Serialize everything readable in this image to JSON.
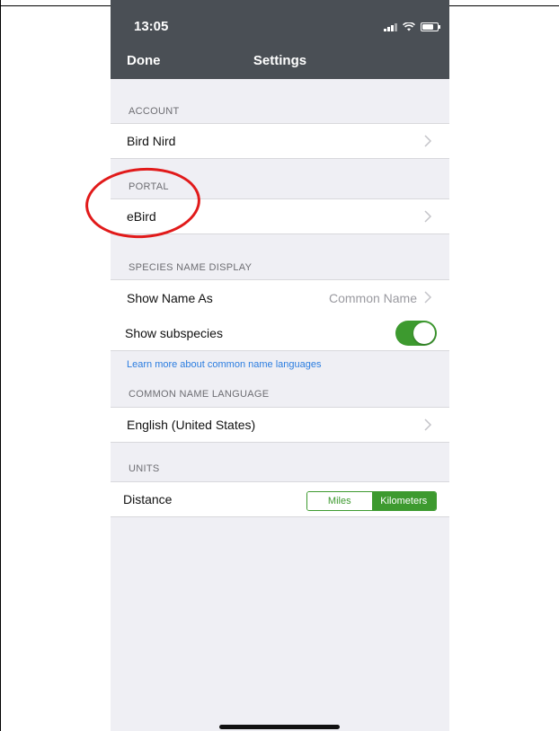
{
  "status_bar": {
    "time": "13:05"
  },
  "navbar": {
    "done_label": "Done",
    "title": "Settings"
  },
  "sections": {
    "account": {
      "header": "ACCOUNT",
      "rows": [
        {
          "label": "Bird Nird"
        }
      ]
    },
    "portal": {
      "header": "PORTAL",
      "rows": [
        {
          "label": "eBird"
        }
      ]
    },
    "species_name_display": {
      "header": "SPECIES NAME DISPLAY",
      "show_name_as": {
        "label": "Show Name As",
        "value": "Common Name"
      },
      "show_subspecies": {
        "label": "Show subspecies",
        "on": true
      },
      "learn_more_link": "Learn more about common name languages"
    },
    "common_name_language": {
      "header": "COMMON NAME LANGUAGE",
      "rows": [
        {
          "label": "English (United States)"
        }
      ]
    },
    "units": {
      "header": "UNITS",
      "distance": {
        "label": "Distance",
        "options": [
          "Miles",
          "Kilometers"
        ],
        "selected": "Kilometers"
      }
    }
  },
  "colors": {
    "navbar": "#4a4f55",
    "accent_green": "#3d9a2f",
    "link_blue": "#2b7de0",
    "annotation_red": "#e11a1a",
    "background": "#efeff4"
  }
}
